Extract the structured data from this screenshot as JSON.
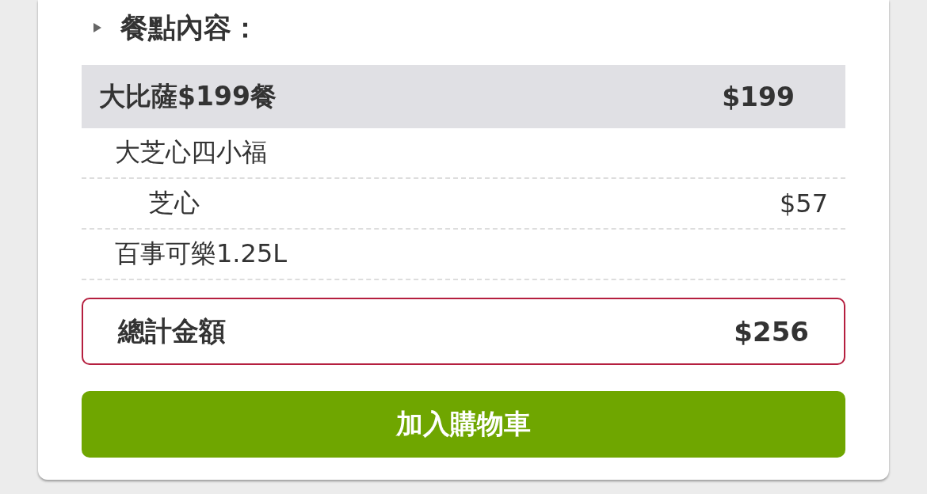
{
  "section_title": "餐點內容：",
  "meal": {
    "name": "大比薩$199餐",
    "price": "$199"
  },
  "items": [
    {
      "name": "大芝心四小福",
      "children": [
        {
          "name": "芝心",
          "price": "$57"
        }
      ]
    },
    {
      "name": "百事可樂1.25L"
    }
  ],
  "total": {
    "label": "總計金額",
    "amount": "$256"
  },
  "add_to_cart_button": "加入購物車"
}
